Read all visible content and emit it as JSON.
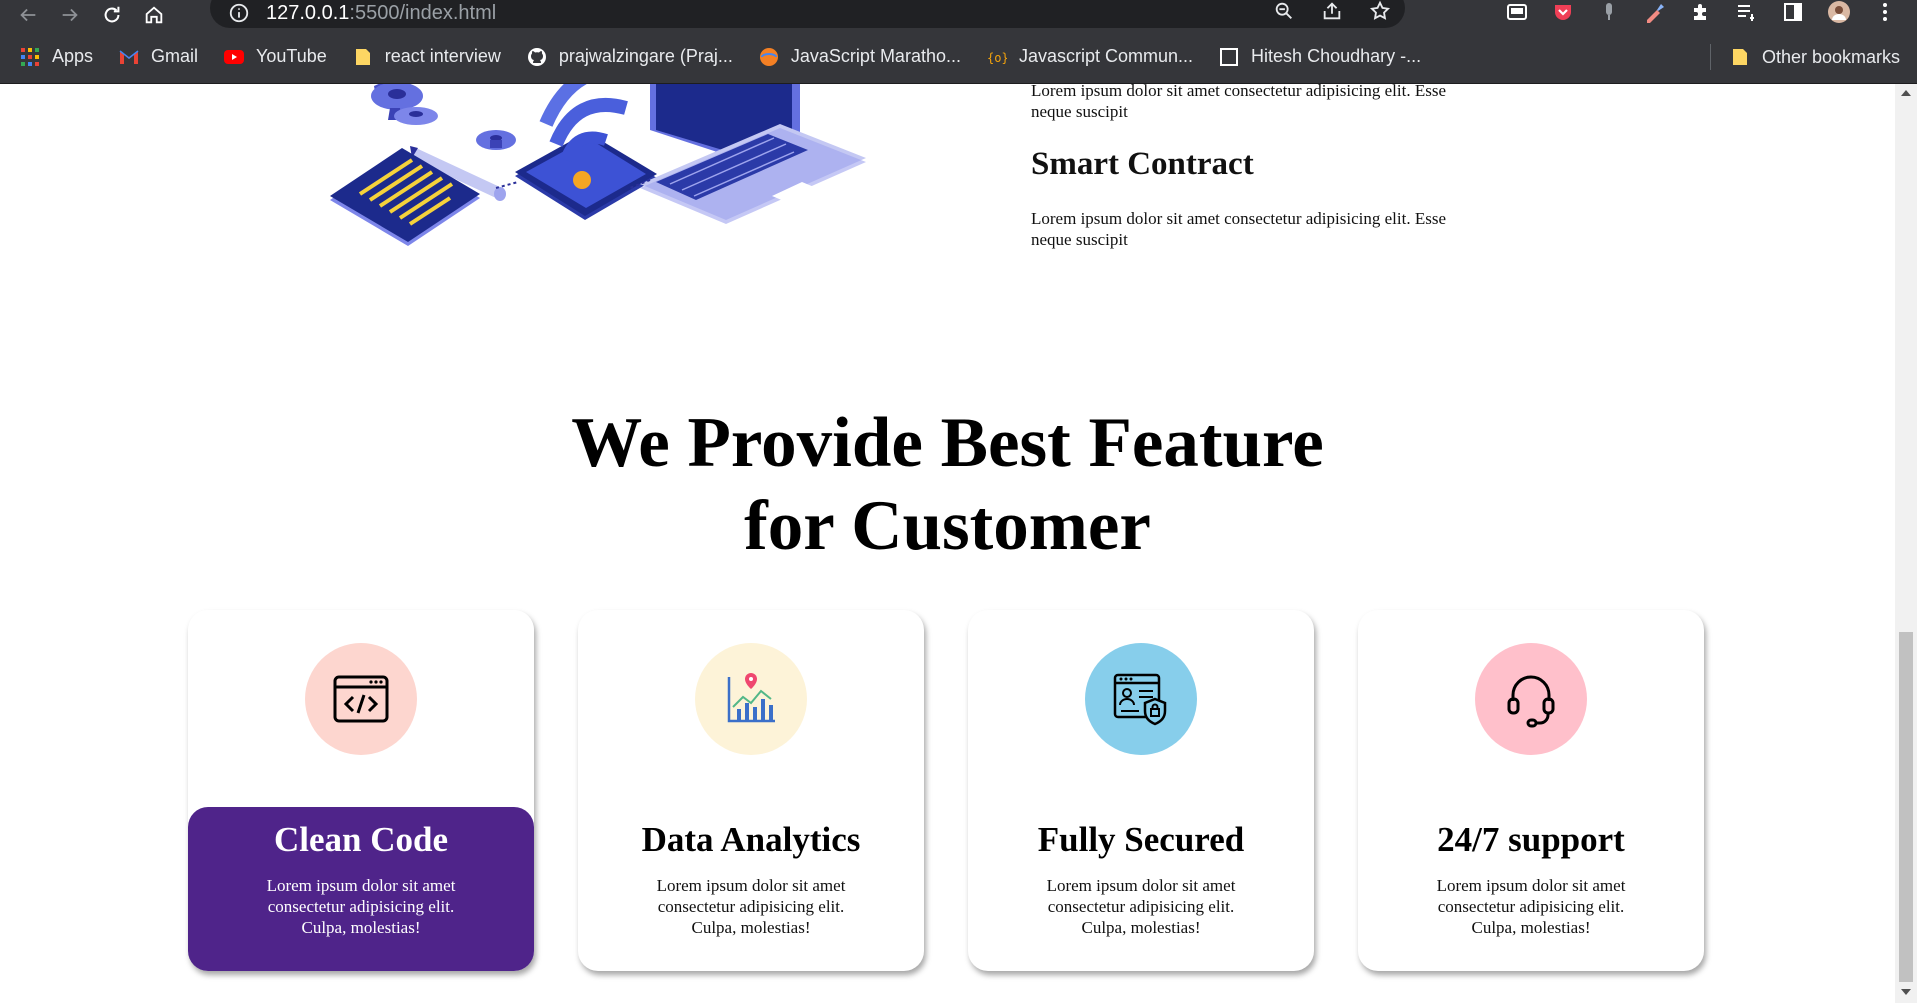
{
  "browser": {
    "url_host": "127.0.0.1",
    "url_rest": ":5500/index.html",
    "bookmarks": [
      {
        "label": "Apps"
      },
      {
        "label": "Gmail"
      },
      {
        "label": "YouTube"
      },
      {
        "label": "react interview"
      },
      {
        "label": "prajwalzingare (Praj..."
      },
      {
        "label": "JavaScript Maratho..."
      },
      {
        "label": "Javascript Commun..."
      },
      {
        "label": "Hitesh Choudhary -..."
      }
    ],
    "other_bookmarks": "Other bookmarks"
  },
  "info": {
    "para_top": "Lorem ipsum dolor sit amet consectetur adipisicing elit. Esse neque suscipit",
    "smart_title": "Smart Contract",
    "para_bottom": "Lorem ipsum dolor sit amet consectetur adipisicing elit. Esse neque suscipit"
  },
  "features": {
    "heading_line1": "We Provide Best Feature",
    "heading_line2": "for Customer",
    "cards": [
      {
        "title": "Clean Code",
        "desc": "Lorem ipsum dolor sit amet consectetur adipisicing elit. Culpa, molestias!",
        "icon": "code-window-icon",
        "circle_color": "#fdd6cf"
      },
      {
        "title": "Data Analytics",
        "desc": "Lorem ipsum dolor sit amet consectetur adipisicing elit. Culpa, molestias!",
        "icon": "analytics-chart-icon",
        "circle_color": "#fdf3d8"
      },
      {
        "title": "Fully Secured",
        "desc": "Lorem ipsum dolor sit amet consectetur adipisicing elit. Culpa, molestias!",
        "icon": "secure-shield-icon",
        "circle_color": "#87ceeb"
      },
      {
        "title": "24/7 support",
        "desc": "Lorem ipsum dolor sit amet consectetur adipisicing elit. Culpa, molestias!",
        "icon": "headset-icon",
        "circle_color": "#ffc0cb"
      }
    ],
    "active_color": "#4f248a"
  }
}
